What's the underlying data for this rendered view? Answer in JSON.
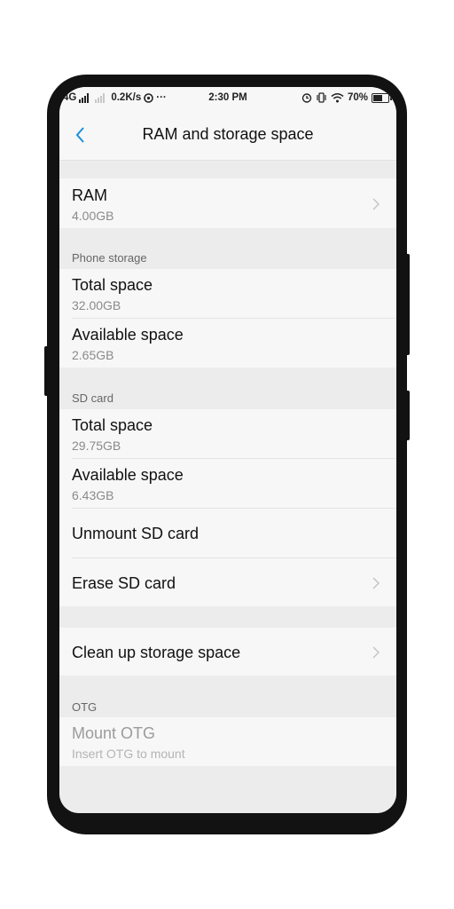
{
  "status_bar": {
    "network": "4G",
    "speed": "0.2K/s",
    "more": "···",
    "time": "2:30 PM",
    "battery": "70%",
    "battery_level": 0.7
  },
  "header": {
    "title": "RAM and storage space"
  },
  "ram": {
    "label": "RAM",
    "value": "4.00GB"
  },
  "phone_storage": {
    "section": "Phone storage",
    "total_label": "Total space",
    "total_value": "32.00GB",
    "available_label": "Available space",
    "available_value": "2.65GB"
  },
  "sd_card": {
    "section": "SD card",
    "total_label": "Total space",
    "total_value": "29.75GB",
    "available_label": "Available space",
    "available_value": "6.43GB",
    "unmount_label": "Unmount SD card",
    "erase_label": "Erase SD card"
  },
  "cleanup": {
    "label": "Clean up storage space"
  },
  "otg": {
    "section": "OTG",
    "mount_label": "Mount OTG",
    "mount_hint": "Insert OTG to mount"
  },
  "colors": {
    "accent": "#1a8fe0",
    "row_bg": "#f7f7f7",
    "gap_bg": "#ececec"
  }
}
